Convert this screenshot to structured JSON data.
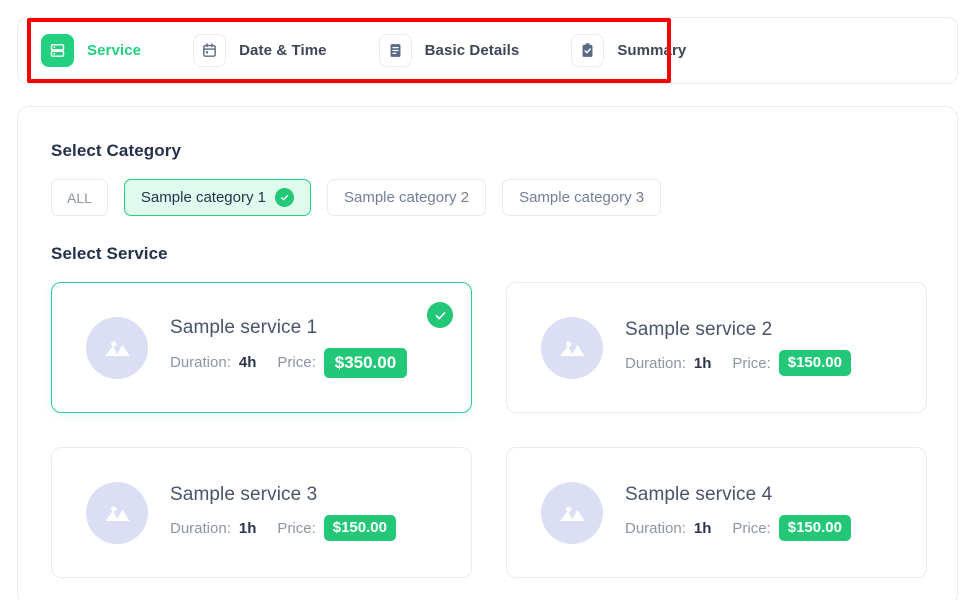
{
  "stepper": {
    "steps": [
      {
        "label": "Service",
        "icon": "list-rows-icon",
        "state": "active"
      },
      {
        "label": "Date & Time",
        "icon": "calendar-icon",
        "state": "inactive"
      },
      {
        "label": "Basic Details",
        "icon": "document-lines-icon",
        "state": "inactive"
      },
      {
        "label": "Summary",
        "icon": "clipboard-check-icon",
        "state": "inactive"
      }
    ]
  },
  "annotation": {
    "color": "#fa0000"
  },
  "content": {
    "category_section_title": "Select Category",
    "service_section_title": "Select Service",
    "categories": [
      {
        "label": "ALL",
        "selected": false
      },
      {
        "label": "Sample category 1",
        "selected": true
      },
      {
        "label": "Sample category 2",
        "selected": false
      },
      {
        "label": "Sample category 3",
        "selected": false
      }
    ],
    "duration_label": "Duration:",
    "price_label": "Price:",
    "services": [
      {
        "name": "Sample service 1",
        "duration": "4h",
        "price": "$350.00",
        "selected": true
      },
      {
        "name": "Sample service 2",
        "duration": "1h",
        "price": "$150.00",
        "selected": false
      },
      {
        "name": "Sample service 3",
        "duration": "1h",
        "price": "$150.00",
        "selected": false
      },
      {
        "name": "Sample service 4",
        "duration": "1h",
        "price": "$150.00",
        "selected": false
      }
    ]
  },
  "colors": {
    "accent_green": "#22d07f",
    "badge_green": "#22c877",
    "selected_pill_bg": "#dffbee",
    "annotation_red": "#fa0000",
    "heading": "#25304a",
    "muted_text": "#8d94a4",
    "thumb_bg": "#dcdff3"
  }
}
